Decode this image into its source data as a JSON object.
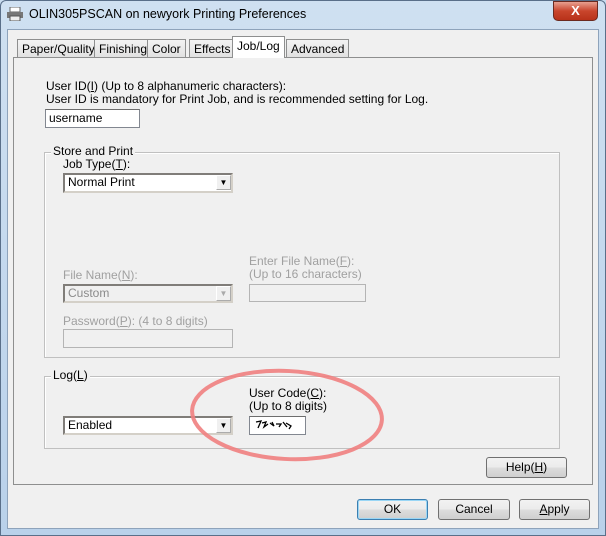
{
  "window": {
    "title": "OLIN305PSCAN on newyork Printing Preferences",
    "close_label": "X"
  },
  "tabs": [
    {
      "label": "Paper/Quality"
    },
    {
      "label": "Finishing"
    },
    {
      "label": "Color"
    },
    {
      "label": "Effects"
    },
    {
      "label": "Job/Log",
      "active": true
    },
    {
      "label": "Advanced"
    }
  ],
  "user_id": {
    "label_pre": "User ID(",
    "key": "I",
    "label_post": ") (Up to 8 alphanumeric characters):",
    "note": "User ID is mandatory for Print Job, and is recommended setting for Log.",
    "value": "username"
  },
  "store_print": {
    "legend": "Store and Print",
    "job_type": {
      "label_pre": "Job Type(",
      "key": "T",
      "label_post": "):",
      "value": "Normal Print"
    },
    "file_name": {
      "label_pre": "File Name(",
      "key": "N",
      "label_post": "):",
      "value": "Custom",
      "disabled": true
    },
    "enter_file_name": {
      "label_pre": "Enter File Name(",
      "key": "F",
      "label_post": "):",
      "note": "(Up to 16 characters)",
      "value": "",
      "disabled": true
    },
    "password": {
      "label_pre": "Password(",
      "key": "P",
      "label_post": "): (4 to 8 digits)",
      "value": "",
      "disabled": true
    }
  },
  "log": {
    "legend_pre": "Log(",
    "key": "L",
    "legend_post": ")",
    "value": "Enabled",
    "user_code": {
      "label_pre": "User Code(",
      "key": "C",
      "label_post": "):",
      "note": "(Up to 8 digits)"
    },
    "annotation_color": "#f08080"
  },
  "buttons": {
    "help_pre": "Help(",
    "help_key": "H",
    "help_post": ")",
    "ok": "OK",
    "cancel": "Cancel",
    "apply_key": "A",
    "apply_post": "pply"
  }
}
